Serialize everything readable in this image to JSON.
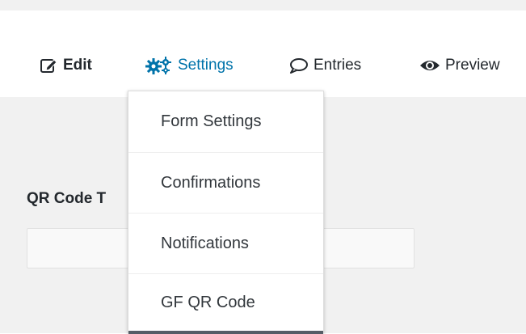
{
  "tabs": {
    "edit": "Edit",
    "settings": "Settings",
    "entries": "Entries",
    "preview": "Preview"
  },
  "settings_menu": {
    "items": [
      "Form Settings",
      "Confirmations",
      "Notifications",
      "GF QR Code"
    ]
  },
  "form": {
    "field_label": "QR Code T",
    "field_value": ""
  },
  "colors": {
    "accent": "#0073aa",
    "text": "#23282d",
    "active_indicator": "#555d66",
    "content_background": "#f1f1f1"
  },
  "icons": [
    "edit-icon",
    "gears-icon",
    "comment-icon",
    "eye-icon"
  ]
}
